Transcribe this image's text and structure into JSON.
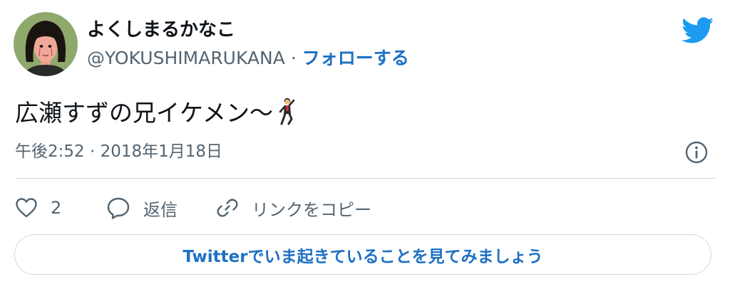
{
  "author": {
    "display_name": "よくしまるかなこ",
    "handle": "@YOKUSHIMARUKANA",
    "separator": "·",
    "follow_label": "フォローする"
  },
  "tweet": {
    "text": "広瀬すずの兄イケメン〜",
    "emoji": "man-dancing",
    "timestamp": "午後2:52 · 2018年1月18日"
  },
  "actions": {
    "like_count": "2",
    "reply_label": "返信",
    "copy_link_label": "リンクをコピー"
  },
  "cta": {
    "label": "Twitterでいま起きていることを見てみましょう"
  },
  "colors": {
    "accent": "#1d70c4",
    "twitter_blue": "#1d9bf0",
    "text": "#0f1419",
    "muted": "#536471",
    "border": "#cfd9de"
  }
}
